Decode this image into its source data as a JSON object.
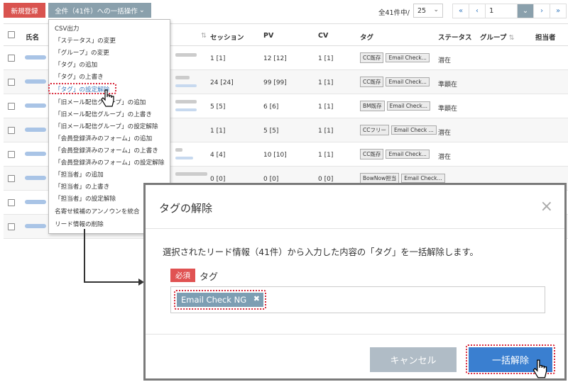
{
  "toolbar": {
    "new_label": "新規登録",
    "bulk_label": "全件（41件）への一括操作",
    "count_text": "全41件中/",
    "per_page": "25",
    "pager_first": "«",
    "pager_prev": "‹",
    "current_page": "1",
    "pager_next": "›",
    "pager_last": "»"
  },
  "table": {
    "headers": {
      "name": "氏名",
      "session": "セッション",
      "pv": "PV",
      "cv": "CV",
      "tag": "タグ",
      "status": "ステータス",
      "group": "グループ",
      "owner": "担当者"
    },
    "rows": [
      {
        "session": "1 [1]",
        "pv": "12 [12]",
        "cv": "1 [1]",
        "tags": [
          "CC既存",
          "Email Check..."
        ],
        "status": "潜在"
      },
      {
        "session": "24 [24]",
        "pv": "99 [99]",
        "cv": "1 [1]",
        "tags": [
          "CC既存",
          "Email Check..."
        ],
        "status": "準顕在"
      },
      {
        "session": "5 [5]",
        "pv": "6 [6]",
        "cv": "1 [1]",
        "tags": [
          "BM既存",
          "Email Check..."
        ],
        "status": "準顕在"
      },
      {
        "session": "1 [1]",
        "pv": "5 [5]",
        "cv": "1 [1]",
        "tags": [
          "CCフリー",
          "Email Check ..."
        ],
        "status": "潜在"
      },
      {
        "session": "4 [4]",
        "pv": "10 [10]",
        "cv": "1 [1]",
        "tags": [
          "CC既存",
          "Email Check..."
        ],
        "status": "潜在"
      },
      {
        "session": "0 [0]",
        "pv": "0 [0]",
        "cv": "0 [0]",
        "tags": [
          "BowNow担当",
          "Email Check..."
        ],
        "status": ""
      }
    ]
  },
  "menu": {
    "items": [
      "CSV出力",
      "「ステータス」の変更",
      "「グループ」の変更",
      "「タグ」の追加",
      "「タグ」の上書き",
      "「タグ」の設定解除",
      "「旧メール配信グループ」の追加",
      "「旧メール配信グループ」の上書き",
      "「旧メール配信グループ」の設定解除",
      "「会員登録済みのフォーム」の追加",
      "「会員登録済みのフォーム」の上書き",
      "「会員登録済みのフォーム」の設定解除",
      "「担当者」の追加",
      "「担当者」の上書き",
      "「担当者」の設定解除",
      "名寄せ候補のアンノウンを統合",
      "リード情報の削除"
    ]
  },
  "modal": {
    "title": "タグの解除",
    "close": "×",
    "description": "選択されたリード情報（41件）から入力した内容の「タグ」を一括解除します。",
    "required_badge": "必須",
    "field_label": "タグ",
    "chip_label": "Email Check NG",
    "chip_remove": "✖",
    "cancel_label": "キャンセル",
    "submit_label": "一括解除"
  },
  "colors": {
    "new_button": "#d9534f",
    "bulk_button": "#8aa0ac",
    "highlight": "#d8283a",
    "submit": "#3a7fd0",
    "cancel": "#b0bcc6",
    "chip": "#7d9eb3"
  }
}
